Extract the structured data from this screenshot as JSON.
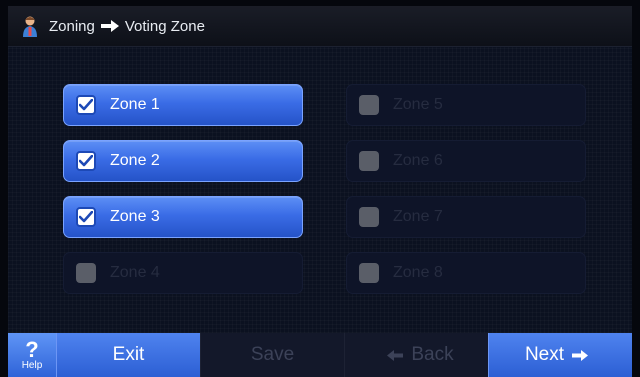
{
  "header": {
    "title_part1": "Zoning",
    "title_part2": "Voting Zone",
    "logo_icon": "person-logo-icon",
    "separator_icon": "arrow-right-icon"
  },
  "zones": [
    {
      "label": "Zone 1",
      "checked": true,
      "enabled": true
    },
    {
      "label": "Zone 2",
      "checked": true,
      "enabled": true
    },
    {
      "label": "Zone 3",
      "checked": true,
      "enabled": true
    },
    {
      "label": "Zone 4",
      "checked": false,
      "enabled": false
    },
    {
      "label": "Zone 5",
      "checked": false,
      "enabled": false
    },
    {
      "label": "Zone 6",
      "checked": false,
      "enabled": false
    },
    {
      "label": "Zone 7",
      "checked": false,
      "enabled": false
    },
    {
      "label": "Zone 8",
      "checked": false,
      "enabled": false
    }
  ],
  "footer": {
    "help_label": "Help",
    "help_glyph": "?",
    "exit_label": "Exit",
    "save_label": "Save",
    "back_label": "Back",
    "next_label": "Next"
  },
  "colors": {
    "accent": "#3a6ce6",
    "disabled_tile": "#0e1428",
    "background": "#0b1120"
  }
}
